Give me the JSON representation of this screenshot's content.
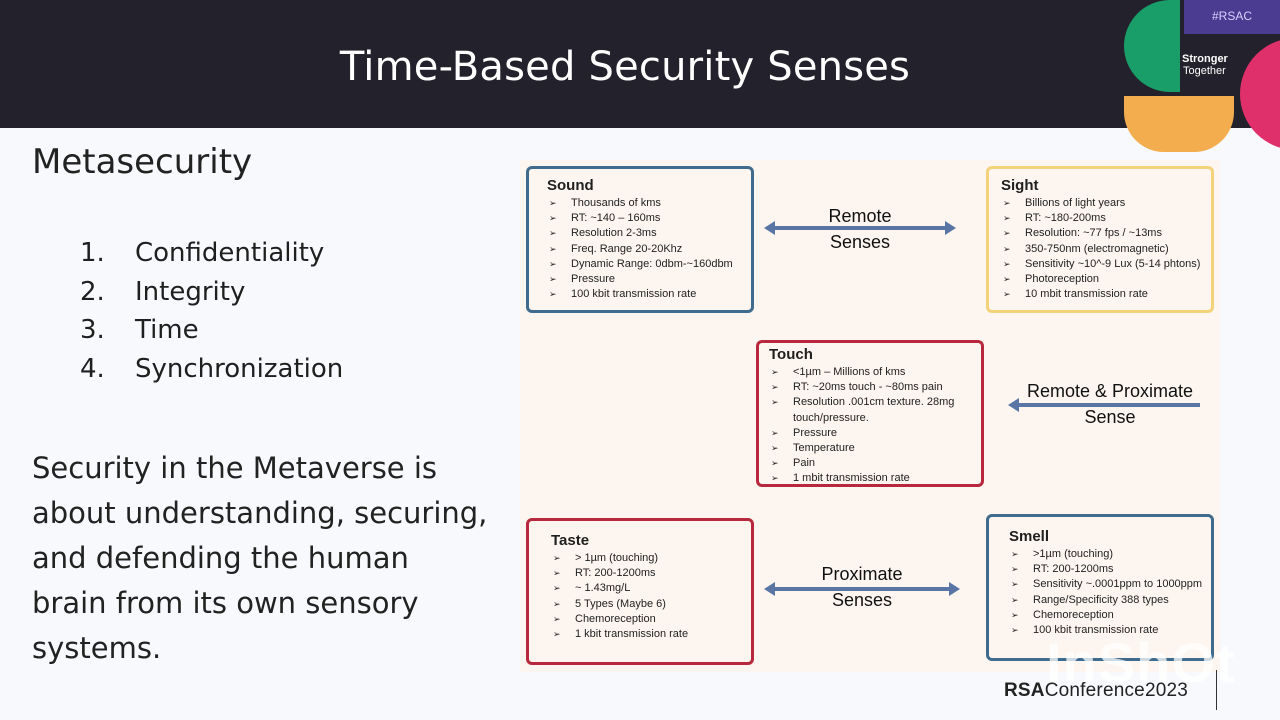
{
  "slide": {
    "title": "Time-Based Security Senses"
  },
  "branding": {
    "hashtag": "#RSAC",
    "tagline_bold": "Stronger",
    "tagline_regular": "Together",
    "footer_brand": "RSA",
    "footer_event": "Conference2023",
    "watermark": "InShOt",
    "colors": {
      "header_bg": "#23212b",
      "green": "#1fa16b",
      "purple": "#4b3b91",
      "orange": "#f3ad4f",
      "pink": "#e0306b"
    }
  },
  "left_panel": {
    "title": "Metasecurity",
    "pillars": [
      {
        "num": "1.",
        "label": "Confidentiality"
      },
      {
        "num": "2.",
        "label": "Integrity"
      },
      {
        "num": "3.",
        "label": "Time"
      },
      {
        "num": "4.",
        "label": "Synchronization"
      }
    ],
    "statement": "Security in the Metaverse is about understanding, securing, and defending the human brain from its own sensory systems."
  },
  "diagram": {
    "senses": {
      "sound": {
        "name": "Sound",
        "items": [
          "Thousands of kms",
          "RT: ~140 – 160ms",
          "Resolution 2-3ms",
          "Freq. Range 20-20Khz",
          "Dynamic Range: 0dbm-~160dbm",
          "Pressure",
          "100 kbit transmission rate"
        ]
      },
      "sight": {
        "name": "Sight",
        "items": [
          "Billions of light years",
          "RT: ~180-200ms",
          "Resolution: ~77 fps / ~13ms",
          "350-750nm (electromagnetic)",
          "Sensitivity ~10^-9 Lux (5-14 phtons)",
          "Photoreception",
          "10 mbit transmission rate"
        ]
      },
      "touch": {
        "name": "Touch",
        "items": [
          "<1µm – Millions of kms",
          "RT: ~20ms touch - ~80ms pain",
          "Resolution .001cm texture. 28mg touch/pressure.",
          "Pressure",
          "Temperature",
          "Pain",
          "1 mbit transmission rate"
        ]
      },
      "taste": {
        "name": "Taste",
        "items": [
          "> 1µm (touching)",
          "RT: 200-1200ms",
          "~ 1.43mg/L",
          "5 Types (Maybe 6)",
          "Chemoreception",
          "1 kbit transmission rate"
        ]
      },
      "smell": {
        "name": "Smell",
        "items": [
          ">1µm (touching)",
          "RT: 200-1200ms",
          "Sensitivity ~.0001ppm to 1000ppm",
          "Range/Specificity 388 types",
          "Chemoreception",
          "100 kbit transmission rate"
        ]
      }
    },
    "connectors": {
      "remote": {
        "line1": "Remote",
        "line2": "Senses"
      },
      "remote_proximate": {
        "line1": "Remote & Proximate",
        "line2": "Sense"
      },
      "proximate": {
        "line1": "Proximate",
        "line2": "Senses"
      }
    },
    "colors": {
      "remote_border": "#3f6b8f",
      "sight_border": "#f2d37a",
      "proximate_border": "#b8283c",
      "arrow": "#5975a3",
      "background": "#fdf5ef"
    }
  }
}
